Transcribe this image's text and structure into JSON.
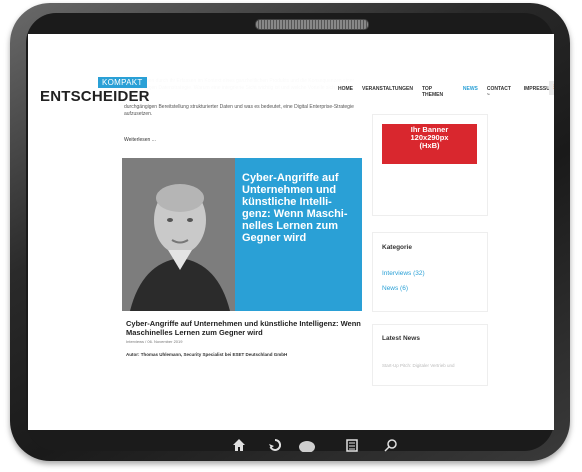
{
  "header": {
    "logo_top": "KOMPAKT",
    "logo_main": "ENTSCHEIDER",
    "nav": [
      {
        "label": "HOME",
        "active": false
      },
      {
        "label": "VERANSTALTUNGEN",
        "active": false
      },
      {
        "label": "TOP THEMEN",
        "active": false
      },
      {
        "label": "NEWS",
        "active": true
      },
      {
        "label": "CONTACT ~",
        "active": false
      },
      {
        "label": "IMPRESSUM",
        "active": false
      }
    ],
    "menu_icon": "≡"
  },
  "article_prev": {
    "text": "durchgängigen Bereitstellung strukturierter Daten und was es bedeutet, eine Digital Enterprise-Strategie aufzusetzen.",
    "read_more": "Weiterlesen ..."
  },
  "article": {
    "card_title": "Cyber-Angriffe auf Unternehmen und künstliche Intelli-genz: Wenn Maschi-nelles Lernen zum Gegner wird",
    "title": "Cyber-Angriffe auf Unternehmen und künstliche Intelligenz: Wenn Maschinelles Lernen zum Gegner wird",
    "meta": "Interviews  /  06. November 2019",
    "author": "Autor: Thomas Uhlemann, Security Specialist bei ESET Deutschland GmbH"
  },
  "sidebar": {
    "banner_line1": "Ihr Banner",
    "banner_line2": "120x290px",
    "banner_line3": "(HxB)",
    "category_title": "Kategorie",
    "categories": [
      {
        "label": "Interviews (32)"
      },
      {
        "label": "News (6)"
      }
    ],
    "latest_title": "Latest News",
    "latest_preview": "Start-Up Pitch: Digitaler Vertrieb und"
  },
  "dock": {
    "home_icon": "home-icon",
    "back_icon": "back-icon",
    "button_icon": "home-button-icon",
    "tabs_icon": "tabs-icon",
    "search_icon": "search-icon"
  }
}
